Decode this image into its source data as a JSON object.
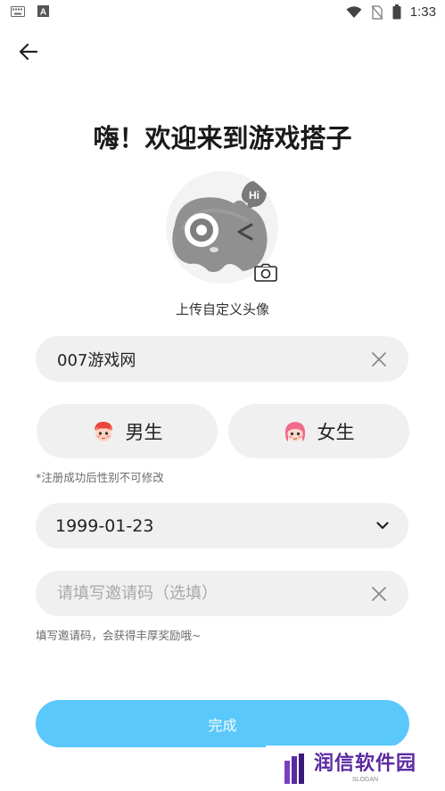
{
  "status_bar": {
    "time": "1:33",
    "left_icons": [
      "keyboard-icon",
      "a-badge-icon"
    ],
    "right_icons": [
      "wifi-icon",
      "no-sim-icon",
      "battery-icon"
    ]
  },
  "header": {
    "back_icon": "arrow-left-icon"
  },
  "title": "嗨！欢迎来到游戏搭子",
  "avatar": {
    "upload_label": "上传自定义头像",
    "camera_icon": "camera-icon"
  },
  "name_field": {
    "value": "007游戏网"
  },
  "gender": {
    "male_label": "男生",
    "female_label": "女生",
    "note": "*注册成功后性别不可修改"
  },
  "birthday": {
    "value": "1999-01-23"
  },
  "invite": {
    "placeholder": "请填写邀请码（选填）",
    "note": "填写邀请码，会获得丰厚奖励哦~"
  },
  "done_button": {
    "label": "完成"
  },
  "watermark": {
    "title": "润信软件园",
    "sub": "SLOGAN"
  },
  "colors": {
    "accent": "#5ac8fa",
    "field_bg": "#f0f0f0",
    "watermark": "#5b2aa0"
  }
}
